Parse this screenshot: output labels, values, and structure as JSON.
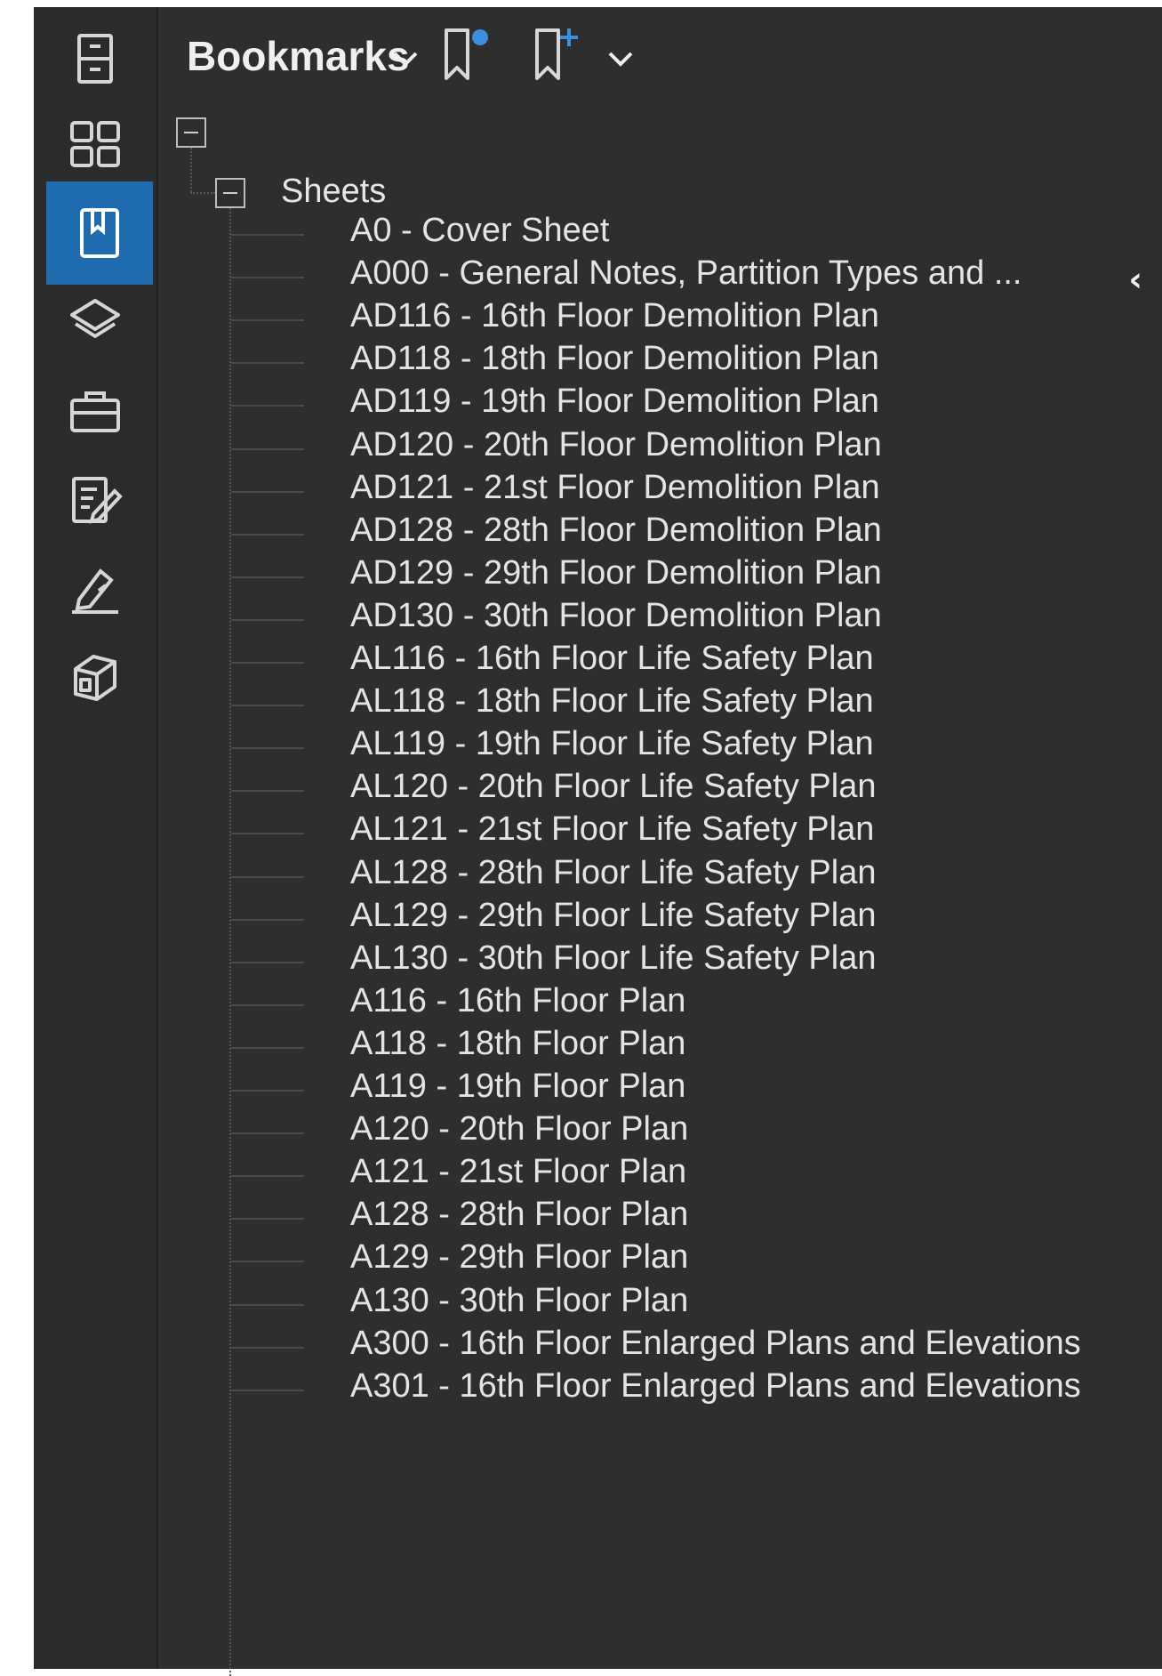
{
  "panel": {
    "title": "Bookmarks"
  },
  "tree": {
    "group_label": "Sheets",
    "items": [
      "A0 - Cover Sheet",
      "A000 - General Notes, Partition Types and ...",
      "AD116 - 16th Floor Demolition Plan",
      "AD118 - 18th Floor Demolition Plan",
      "AD119 - 19th Floor Demolition Plan",
      "AD120 - 20th Floor Demolition Plan",
      "AD121 - 21st Floor Demolition Plan",
      "AD128 - 28th Floor Demolition Plan",
      "AD129 - 29th Floor Demolition Plan",
      "AD130 - 30th Floor Demolition Plan",
      "AL116 - 16th Floor Life Safety Plan",
      "AL118 - 18th Floor Life Safety Plan",
      "AL119 - 19th Floor Life Safety Plan",
      "AL120 - 20th Floor Life Safety Plan",
      "AL121 - 21st Floor Life Safety Plan",
      "AL128 - 28th Floor Life Safety Plan",
      "AL129 - 29th Floor Life Safety Plan",
      "AL130 - 30th Floor Life Safety Plan",
      "A116 - 16th Floor Plan",
      "A118 - 18th Floor Plan",
      "A119 - 19th Floor Plan",
      "A120 - 20th Floor Plan",
      "A121 - 21st Floor Plan",
      "A128 - 28th Floor Plan",
      "A129 - 29th Floor Plan",
      "A130 - 30th Floor Plan",
      "A300 - 16th Floor Enlarged Plans and Elevations",
      "A301 - 16th Floor Enlarged Plans and Elevations"
    ]
  },
  "colors": {
    "accent": "#1e6bb0",
    "bookmark_plus": "#3b8fe0"
  },
  "icons": {
    "rail": [
      "file-cabinet-icon",
      "thumbnails-icon",
      "bookmark-icon",
      "layers-icon",
      "toolbox-icon",
      "markup-list-icon",
      "signature-icon",
      "3d-model-icon"
    ],
    "header": [
      "chevron-down-icon",
      "add-bookmark-icon",
      "add-child-bookmark-icon",
      "chevron-down-icon"
    ]
  }
}
